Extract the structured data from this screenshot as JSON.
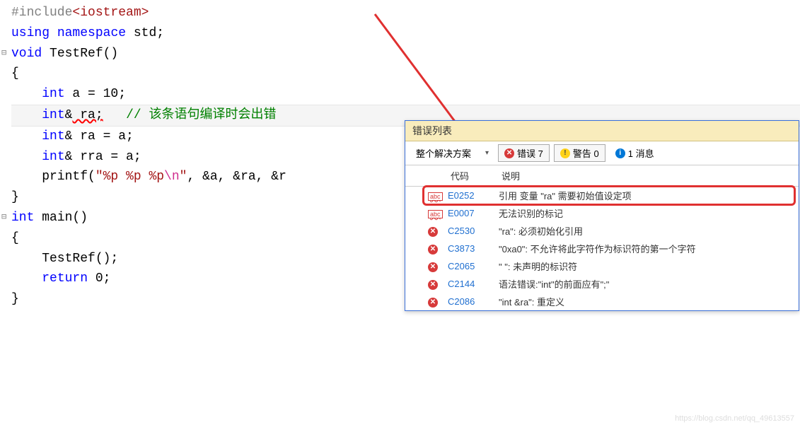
{
  "code": {
    "l1_pre": "#include",
    "l1_path": "<iostream>",
    "l2_kw1": "using",
    "l2_kw2": "namespace",
    "l2_id": " std;",
    "l3": "",
    "l4_kw": "void",
    "l4_fn": " TestRef()",
    "l5": "{",
    "l6_pre": "    ",
    "l6_kw": "int",
    "l6_rest": " a = 10;",
    "l7_pre": "    ",
    "l7_kw": "int",
    "l7_amp": "&",
    "l7_sq": " ra;",
    "l7_sp": "   ",
    "l7_comment": "// 该条语句编译时会出错",
    "l8_pre": "    ",
    "l8_kw": "int",
    "l8_rest": "& ra = a;",
    "l9_pre": "    ",
    "l9_kw": "int",
    "l9_rest": "& rra = a;",
    "l10_pre": "    printf(",
    "l10_str1": "\"%p %p %p",
    "l10_esc": "\\n",
    "l10_str2": "\"",
    "l10_rest": ", &a, &ra, &r",
    "l11": "}",
    "l12": "",
    "l13_kw": "int",
    "l13_fn": " main()",
    "l14": "{",
    "l15": "    TestRef();",
    "l16": "",
    "l17_pre": "    ",
    "l17_kw": "return",
    "l17_rest": " 0;",
    "l18": "}"
  },
  "errorPanel": {
    "title": "错误列表",
    "scope": "整个解决方案",
    "errorBtn": "错误 7",
    "warnBtn": "警告 0",
    "infoBtn": "1 消息",
    "header_code": "代码",
    "header_desc": "说明",
    "rows": [
      {
        "icon": "abc",
        "code": "E0252",
        "desc": "引用 变量 \"ra\" 需要初始值设定项"
      },
      {
        "icon": "abc",
        "code": "E0007",
        "desc": "无法识别的标记"
      },
      {
        "icon": "err",
        "code": "C2530",
        "desc": "\"ra\": 必须初始化引用"
      },
      {
        "icon": "err",
        "code": "C3873",
        "desc": "\"0xa0\": 不允许将此字符作为标识符的第一个字符"
      },
      {
        "icon": "err",
        "code": "C2065",
        "desc": "\" \": 未声明的标识符"
      },
      {
        "icon": "err",
        "code": "C2144",
        "desc": "语法错误:\"int\"的前面应有\";\""
      },
      {
        "icon": "err",
        "code": "C2086",
        "desc": "\"int &ra\": 重定义"
      }
    ]
  },
  "icons": {
    "abc": "abc",
    "err": "✕",
    "warn": "!",
    "info": "i",
    "dropdown": "▾"
  },
  "watermark": "https://blog.csdn.net/qq_49613557"
}
